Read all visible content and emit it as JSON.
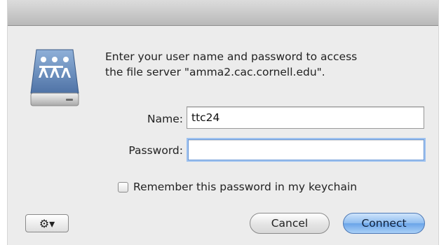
{
  "dialog": {
    "message_line1": "Enter your user name and password to access",
    "message_line2": "the file server \"amma2.cac.cornell.edu\".",
    "server_icon": "file-server-icon"
  },
  "form": {
    "name_label": "Name:",
    "name_value": "ttc24",
    "password_label": "Password:",
    "password_value": "",
    "remember_label": "Remember this password in my keychain",
    "remember_checked": false
  },
  "buttons": {
    "gear_label": "⚙▾",
    "cancel_label": "Cancel",
    "connect_label": "Connect"
  },
  "colors": {
    "dialog_bg": "#ececec",
    "focus_ring": "#9ec2f0",
    "default_button": "#6aa4e8"
  }
}
